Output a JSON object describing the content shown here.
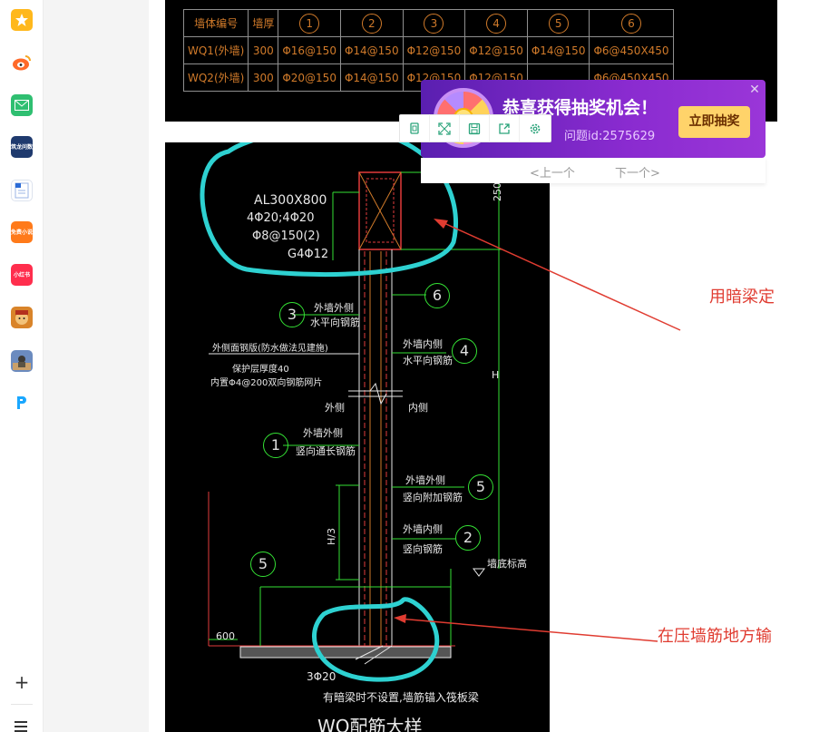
{
  "sidebar": {
    "apps": [
      {
        "icon": "star-favorites-icon",
        "label": "",
        "color": "#ffb81c"
      },
      {
        "icon": "weibo-icon",
        "label": "",
        "color": "#ff6a2a"
      },
      {
        "icon": "mail-icon",
        "label": "",
        "color": "#2fbf71"
      },
      {
        "icon": "zhulong-qa-icon",
        "label": "筑龙问数",
        "color": "#1f3a6e"
      },
      {
        "icon": "word-document-icon",
        "label": "",
        "color": "#2b6bd6"
      },
      {
        "icon": "free-novel-icon",
        "label": "免费小说",
        "color": "#ff7a1a"
      },
      {
        "icon": "xiaohongshu-icon",
        "label": "小红书",
        "color": "#ff2e4d"
      },
      {
        "icon": "game-avatar-icon",
        "label": "",
        "color": "#d9842a"
      },
      {
        "icon": "pubg-game-icon",
        "label": "",
        "color": "#6b8bbf"
      },
      {
        "icon": "p-app-icon",
        "label": "",
        "color": "#1aa7ff"
      }
    ],
    "add_label": "+"
  },
  "cad_table": {
    "header": [
      "墙体编号",
      "墙厚",
      "1",
      "2",
      "3",
      "4",
      "5",
      "6"
    ],
    "rows": [
      [
        "WQ1(外墙)",
        "300",
        "Φ16@150",
        "Φ14@150",
        "Φ12@150",
        "Φ12@150",
        "Φ14@150",
        "Φ6@450X450"
      ],
      [
        "WQ2(外墙)",
        "300",
        "Φ20@150",
        "Φ14@150",
        "Φ12@150",
        "Φ12@150",
        "",
        "Φ6@450X450"
      ]
    ]
  },
  "drawing": {
    "beam_label": [
      "AL300X800",
      "4Φ20;4Φ20",
      "Φ8@150(2)",
      "G4Φ12"
    ],
    "dim_250": "250",
    "dim_H": "H",
    "dim_H3": "H/3",
    "dim_600": "600",
    "circle_labels": [
      "3",
      "6",
      "4",
      "1",
      "5",
      "2",
      "5"
    ],
    "note_3": [
      "外墙外侧",
      "水平向钢筋"
    ],
    "note_waterproof": "外侧面钢版(防水做法见建施)",
    "note_protect": "保护层厚度40",
    "note_mesh": "内置Φ4@200双向钢筋网片",
    "note_4": [
      "外墙内侧",
      "水平向钢筋"
    ],
    "outside": "外侧",
    "inside": "内侧",
    "note_1": [
      "外墙外侧",
      "竖向通长钢筋"
    ],
    "note_5": [
      "外墙外侧",
      "竖向附加钢筋"
    ],
    "note_2": [
      "外墙内侧",
      "竖向钢筋"
    ],
    "wall_bottom": "墙底标高",
    "bottom_bars": "3Φ20",
    "bottom_note": "有暗梁时不设置,墙筋锚入筏板梁",
    "caption": "WQ配筋大样"
  },
  "annotations": {
    "upper": "用暗梁定",
    "lower": "在压墙筋地方输",
    "color": "#e03c31"
  },
  "popup": {
    "title": "恭喜获得抽奖机会！",
    "question_id": "问题id:2575629",
    "button": "立即抽奖",
    "close": "✕",
    "prev": "<上一个",
    "next": "下一个>"
  },
  "toolbar": {
    "buttons": [
      "copy-icon",
      "fullscreen-icon",
      "save-icon",
      "share-icon",
      "settings-icon"
    ]
  }
}
